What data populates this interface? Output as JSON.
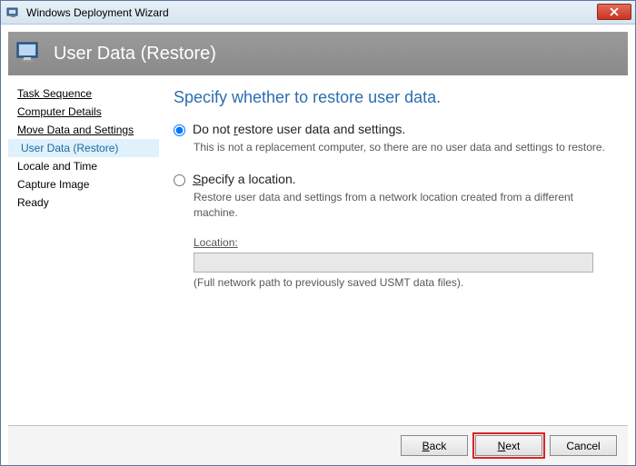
{
  "window": {
    "title": "Windows Deployment Wizard"
  },
  "header": {
    "title": "User Data (Restore)"
  },
  "sidebar": {
    "items": [
      {
        "label": "Task Sequence",
        "state": "done"
      },
      {
        "label": "Computer Details",
        "state": "done"
      },
      {
        "label": "Move Data and Settings",
        "state": "done"
      },
      {
        "label": "User Data (Restore)",
        "state": "active"
      },
      {
        "label": "Locale and Time",
        "state": "pending"
      },
      {
        "label": "Capture Image",
        "state": "pending"
      },
      {
        "label": "Ready",
        "state": "pending"
      }
    ]
  },
  "main": {
    "heading": "Specify whether to restore user data.",
    "option1": {
      "label_pre": "Do not ",
      "label_u": "r",
      "label_post": "estore user data and settings.",
      "desc": "This is not a replacement computer, so there are no user data and settings to restore.",
      "checked": true
    },
    "option2": {
      "label_pre": "",
      "label_u": "S",
      "label_post": "pecify a location.",
      "desc": "Restore user data and settings from a network location created from a different machine.",
      "checked": false
    },
    "location": {
      "label": "Location:",
      "value": "",
      "hint": "(Full network path to previously saved USMT data files)."
    }
  },
  "footer": {
    "back": "Back",
    "next": "Next",
    "cancel": "Cancel"
  }
}
